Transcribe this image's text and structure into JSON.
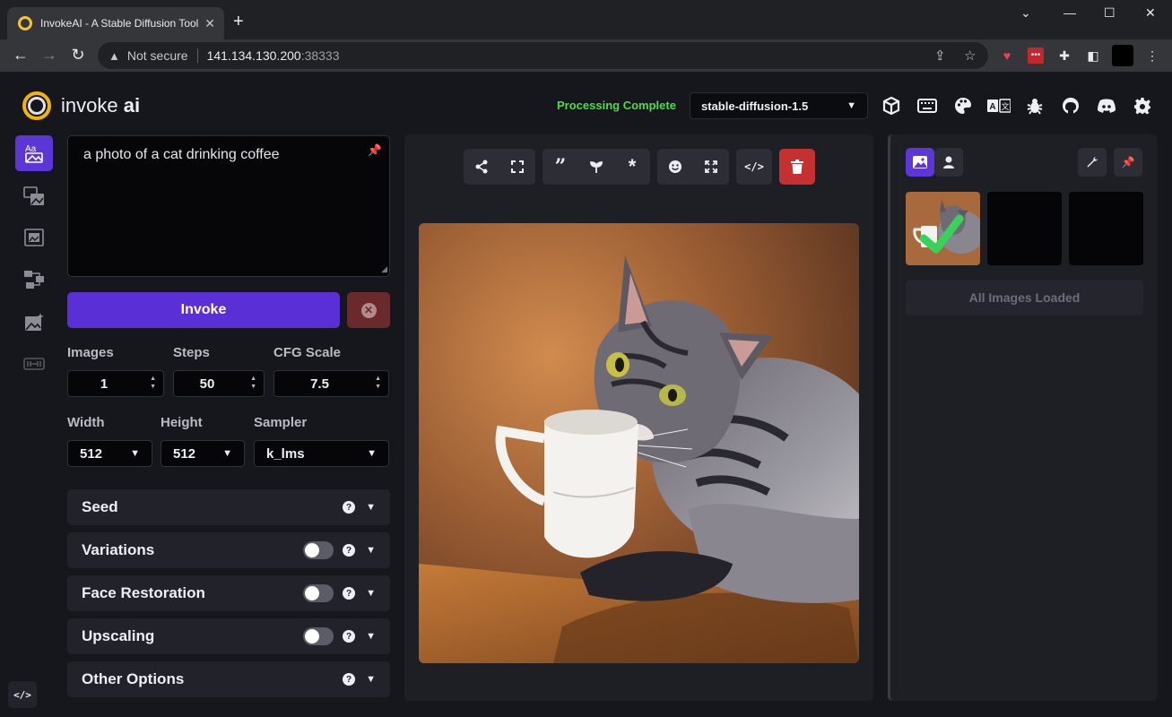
{
  "browser": {
    "tab_title": "InvokeAI - A Stable Diffusion Toolkit",
    "address_warning": "Not secure",
    "address_host": "141.134.130.200",
    "address_port": ":38333"
  },
  "header": {
    "logo_text": "invoke",
    "logo_bold": "ai",
    "status": "Processing Complete",
    "model": "stable-diffusion-1.5",
    "icons": [
      "model-manager-icon",
      "hotkeys-icon",
      "theme-icon",
      "language-icon",
      "bug-report-icon",
      "github-icon",
      "discord-icon",
      "settings-icon"
    ]
  },
  "sidebar": {
    "items": [
      "text-to-image",
      "image-to-image",
      "unified-canvas",
      "nodes",
      "postprocessing",
      "training"
    ]
  },
  "prompt": {
    "value": "a photo of a cat drinking coffee"
  },
  "actions": {
    "invoke_label": "Invoke"
  },
  "params": {
    "images_label": "Images",
    "images_value": "1",
    "steps_label": "Steps",
    "steps_value": "50",
    "cfg_label": "CFG Scale",
    "cfg_value": "7.5",
    "width_label": "Width",
    "width_value": "512",
    "height_label": "Height",
    "height_value": "512",
    "sampler_label": "Sampler",
    "sampler_value": "k_lms"
  },
  "accordions": [
    {
      "label": "Seed",
      "toggle": false
    },
    {
      "label": "Variations",
      "toggle": true
    },
    {
      "label": "Face Restoration",
      "toggle": true
    },
    {
      "label": "Upscaling",
      "toggle": true
    },
    {
      "label": "Other Options",
      "toggle": false
    }
  ],
  "gallery": {
    "status": "All Images Loaded"
  },
  "colors": {
    "accent": "#5b2fd6",
    "status_green": "#4ade4a",
    "danger": "#c53030",
    "logo": "#f4b400"
  }
}
